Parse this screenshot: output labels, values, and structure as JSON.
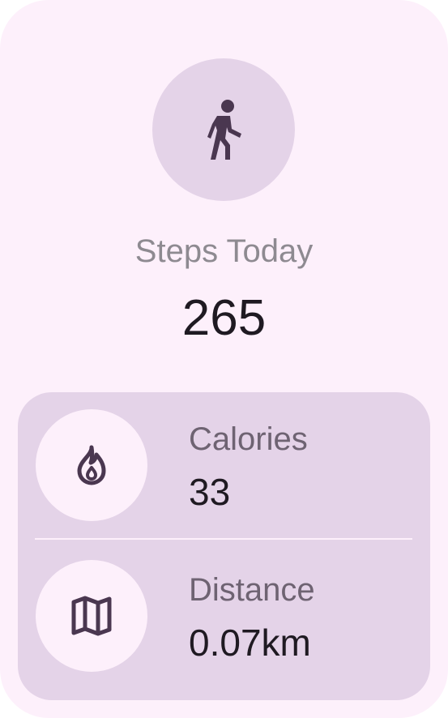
{
  "colors": {
    "card_background": "#fdf0fb",
    "circle_fill": "#e4d3e8",
    "icon_color": "#4a3750",
    "muted_text": "#8e8a91",
    "label_text": "#6e6372",
    "primary_text": "#1f1a22"
  },
  "hero": {
    "icon": "walking-person-icon",
    "label": "Steps Today",
    "value": "265"
  },
  "stats": [
    {
      "icon": "flame-icon",
      "label": "Calories",
      "value": "33"
    },
    {
      "icon": "map-icon",
      "label": "Distance",
      "value": "0.07km"
    }
  ]
}
